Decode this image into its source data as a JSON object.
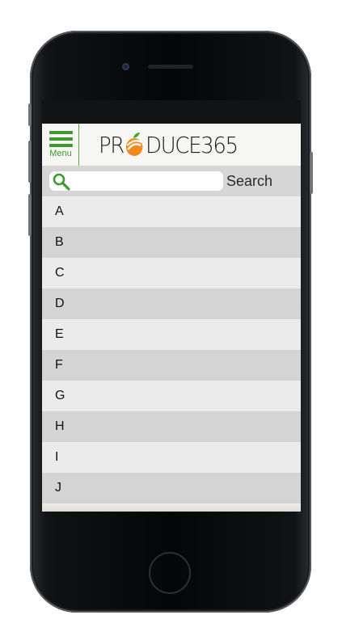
{
  "header": {
    "menu_label": "Menu",
    "logo": {
      "prefix": "PR",
      "suffix": "DUCE365"
    }
  },
  "search": {
    "value": "",
    "placeholder": "",
    "button_label": "Search"
  },
  "alphabet": [
    "A",
    "B",
    "C",
    "D",
    "E",
    "F",
    "G",
    "H",
    "I",
    "J"
  ],
  "colors": {
    "accent_green": "#3f9a2c",
    "logo_orange": "#f08a1c"
  }
}
